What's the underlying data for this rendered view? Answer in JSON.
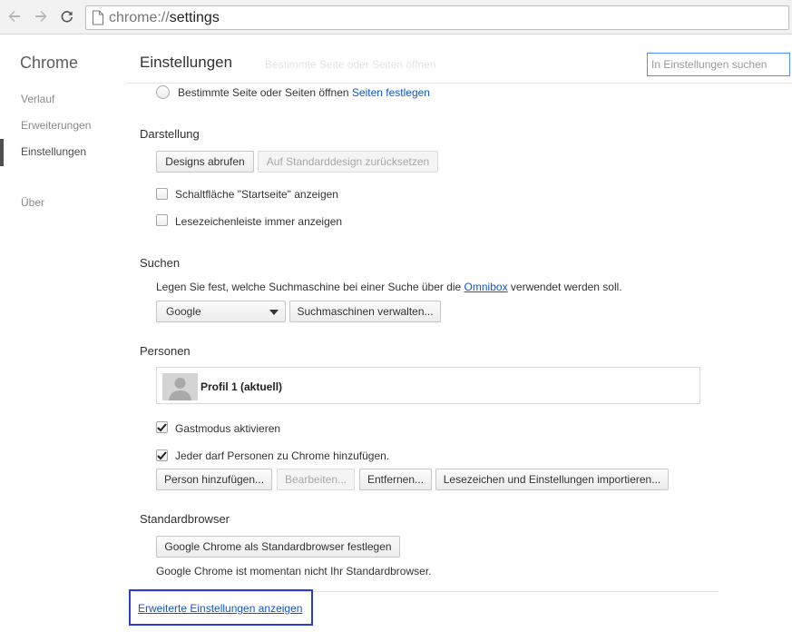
{
  "toolbar": {
    "url_scheme": "chrome://",
    "url_path": "settings",
    "icons": [
      "back-arrow-icon",
      "forward-arrow-icon",
      "reload-icon",
      "page-icon"
    ]
  },
  "sidebar": {
    "brand": "Chrome",
    "items": [
      {
        "label": "Verlauf",
        "active": false
      },
      {
        "label": "Erweiterungen",
        "active": false
      },
      {
        "label": "Einstellungen",
        "active": true
      },
      {
        "label": "Über",
        "active": false
      }
    ]
  },
  "header": {
    "title": "Einstellungen",
    "ghost_text": "Bestimmte Seite oder Seiten öffnen",
    "search_placeholder": "In Einstellungen suchen"
  },
  "startup": {
    "radio_label": "Bestimmte Seite oder Seiten öffnen",
    "link_label": "Seiten festlegen",
    "selected": false
  },
  "appearance": {
    "heading": "Darstellung",
    "get_themes": "Designs abrufen",
    "reset_theme": "Auf Standarddesign zurücksetzen",
    "show_home": {
      "label": "Schaltfläche \"Startseite\" anzeigen",
      "checked": false
    },
    "show_bookmarks": {
      "label": "Lesezeichenleiste immer anzeigen",
      "checked": false
    }
  },
  "search": {
    "heading": "Suchen",
    "desc_before": "Legen Sie fest, welche Suchmaschine bei einer Suche über die ",
    "desc_link": "Omnibox",
    "desc_after": " verwendet werden soll.",
    "engine_selected": "Google",
    "manage_button": "Suchmaschinen verwalten..."
  },
  "people": {
    "heading": "Personen",
    "profile_name": "Profil 1 (aktuell)",
    "guest_mode": {
      "label": "Gastmodus aktivieren",
      "checked": true
    },
    "anyone_add": {
      "label": "Jeder darf Personen zu Chrome hinzufügen.",
      "checked": true
    },
    "add_person": "Person hinzufügen...",
    "edit": "Bearbeiten...",
    "remove": "Entfernen...",
    "import": "Lesezeichen und Einstellungen importieren..."
  },
  "default_browser": {
    "heading": "Standardbrowser",
    "make_default": "Google Chrome als Standardbrowser festlegen",
    "status": "Google Chrome ist momentan nicht Ihr Standardbrowser."
  },
  "advanced": {
    "link_label": "Erweiterte Einstellungen anzeigen"
  },
  "colors": {
    "link": "#1155cc",
    "focus_ring": "#2b3fcf",
    "search_focus": "#4d90fe"
  }
}
